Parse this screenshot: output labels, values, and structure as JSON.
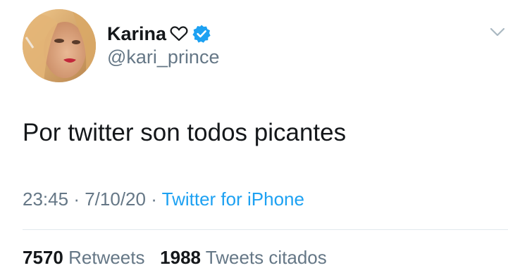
{
  "author": {
    "display_name": "Karina",
    "handle": "@kari_prince",
    "verified": true,
    "avatar": "profile-photo"
  },
  "tweet": {
    "text": "Por twitter son todos picantes",
    "time": "23:45",
    "separator": "·",
    "date": "7/10/20",
    "source": "Twitter for iPhone"
  },
  "stats": {
    "retweets_count": "7570",
    "retweets_label": "Retweets",
    "quotes_count": "1988",
    "quotes_label": "Tweets citados"
  },
  "icons": {
    "heart": "heart-outline-icon",
    "verified": "verified-badge-icon",
    "menu": "chevron-down-icon"
  },
  "colors": {
    "text_primary": "#14171a",
    "text_secondary": "#657786",
    "accent": "#1da1f2",
    "divider": "#e1e8ed"
  }
}
